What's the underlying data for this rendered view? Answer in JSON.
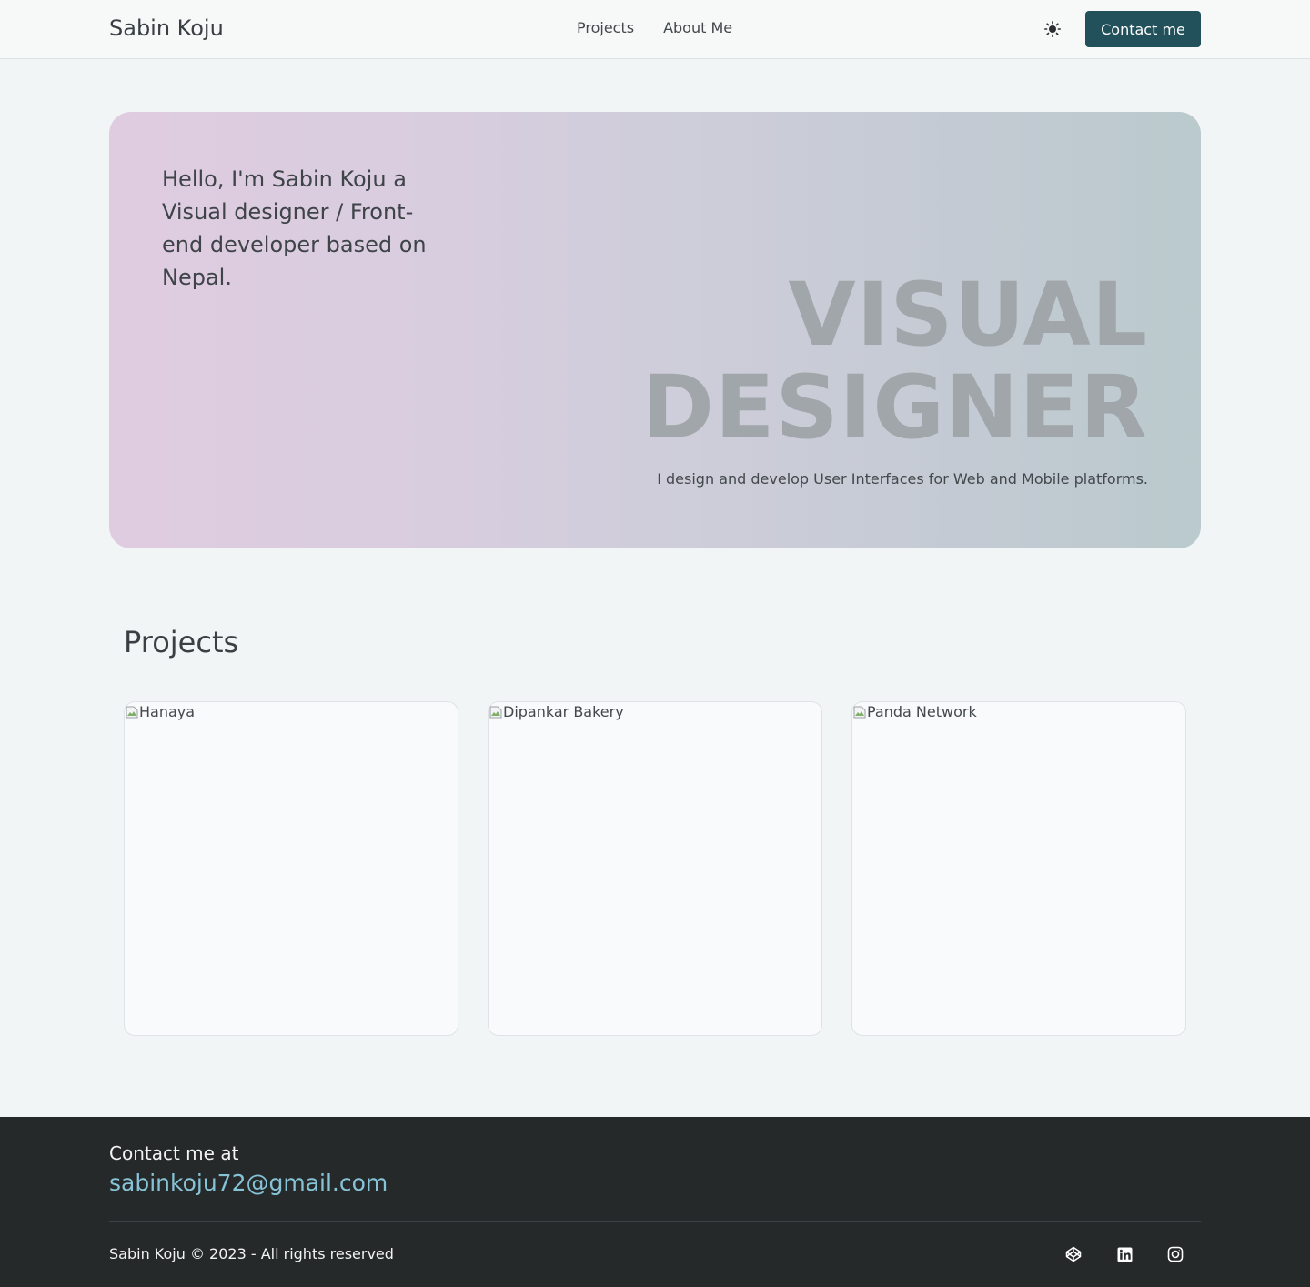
{
  "navbar": {
    "brand": "Sabin Koju",
    "links": [
      {
        "label": "Projects"
      },
      {
        "label": "About Me"
      }
    ],
    "theme_toggle_icon": "sun-icon",
    "contact_label": "Contact me"
  },
  "hero": {
    "intro": "Hello, I'm Sabin Koju a Visual designer / Front-end developer based on Nepal.",
    "headline_line1": "VISUAL",
    "headline_line2": "DESIGNER",
    "tagline": "I design and develop User Interfaces for Web and Mobile platforms."
  },
  "projects": {
    "title": "Projects",
    "items": [
      {
        "alt": "Hanaya"
      },
      {
        "alt": "Dipankar Bakery"
      },
      {
        "alt": "Panda Network"
      }
    ]
  },
  "footer": {
    "contact_label": "Contact me at",
    "email": "sabinkoju72@gmail.com",
    "copyright": "Sabin Koju © 2023 - All rights reserved",
    "socials": [
      {
        "icon": "codepen-icon"
      },
      {
        "icon": "linkedin-icon"
      },
      {
        "icon": "instagram-icon"
      }
    ]
  },
  "colors": {
    "accent": "#22505b",
    "email_link": "#86c3d6",
    "footer_bg": "#25292a",
    "page_bg": "#f1f5f6"
  }
}
